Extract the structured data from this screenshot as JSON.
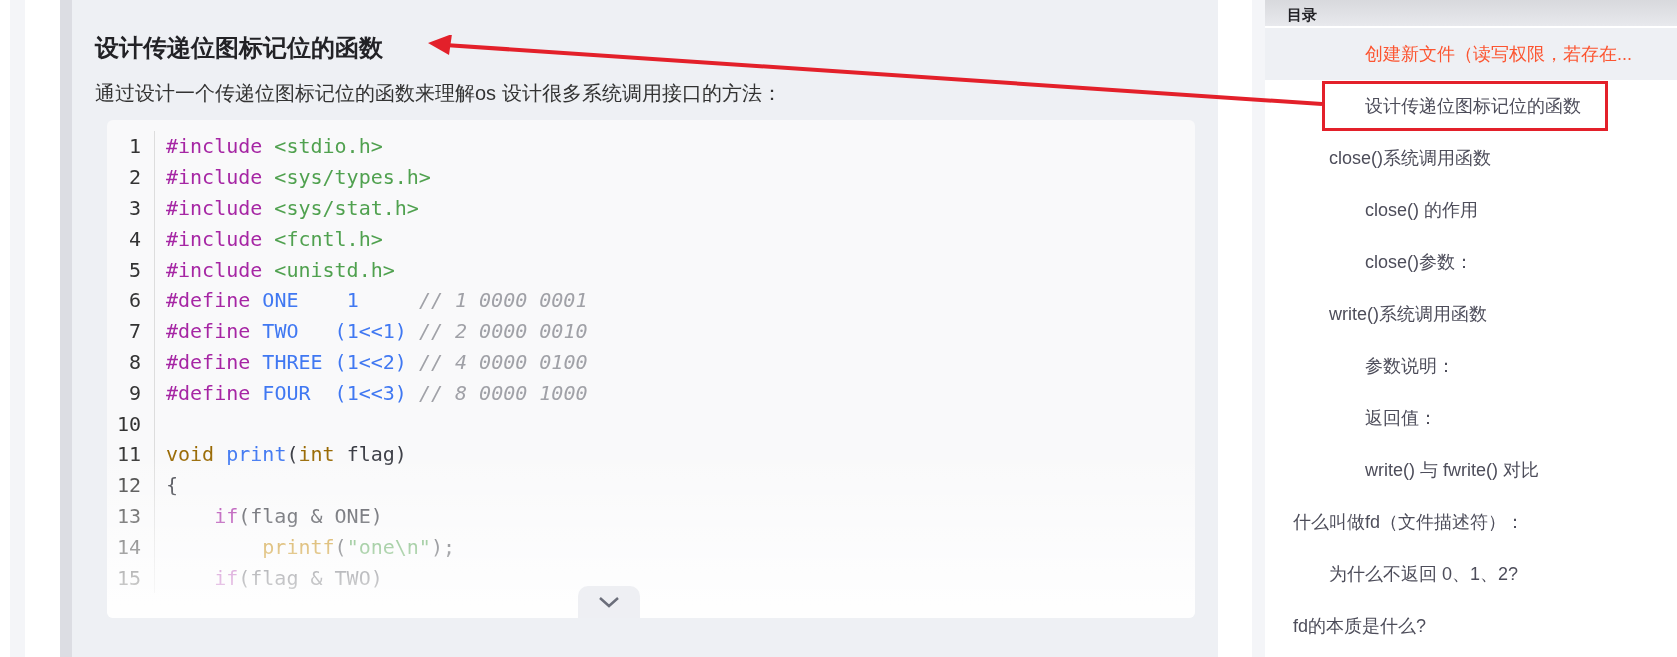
{
  "article": {
    "heading": "设计传递位图标记位的函数",
    "intro": "通过设计一个传递位图标记位的函数来理解os 设计很多系统调用接口的方法：",
    "code": [
      {
        "number": "1",
        "tokens": [
          {
            "kind": "keyword",
            "text": "#include"
          },
          {
            "kind": "string",
            "text": " <stdio.h>"
          }
        ]
      },
      {
        "number": "2",
        "tokens": [
          {
            "kind": "keyword",
            "text": "#include"
          },
          {
            "kind": "string",
            "text": " <sys/types.h>"
          }
        ]
      },
      {
        "number": "3",
        "tokens": [
          {
            "kind": "keyword",
            "text": "#include"
          },
          {
            "kind": "string",
            "text": " <sys/stat.h>"
          }
        ]
      },
      {
        "number": "4",
        "tokens": [
          {
            "kind": "keyword",
            "text": "#include"
          },
          {
            "kind": "string",
            "text": " <fcntl.h>"
          }
        ]
      },
      {
        "number": "5",
        "tokens": [
          {
            "kind": "keyword",
            "text": "#include"
          },
          {
            "kind": "string",
            "text": " <unistd.h>"
          }
        ]
      },
      {
        "number": "6",
        "tokens": [
          {
            "kind": "keyword",
            "text": "#define"
          },
          {
            "kind": "name",
            "text": " ONE    1"
          },
          {
            "kind": "comment",
            "text": "     // 1 0000 0001"
          }
        ]
      },
      {
        "number": "7",
        "tokens": [
          {
            "kind": "keyword",
            "text": "#define"
          },
          {
            "kind": "name",
            "text": " TWO   (1<<1)"
          },
          {
            "kind": "comment",
            "text": " // 2 0000 0010"
          }
        ]
      },
      {
        "number": "8",
        "tokens": [
          {
            "kind": "keyword",
            "text": "#define"
          },
          {
            "kind": "name",
            "text": " THREE (1<<2)"
          },
          {
            "kind": "comment",
            "text": " // 4 0000 0100"
          }
        ]
      },
      {
        "number": "9",
        "tokens": [
          {
            "kind": "keyword",
            "text": "#define"
          },
          {
            "kind": "name",
            "text": " FOUR  (1<<3)"
          },
          {
            "kind": "comment",
            "text": " // 8 0000 1000"
          }
        ]
      },
      {
        "number": "10"
      },
      {
        "number": "11",
        "tokens": [
          {
            "kind": "type",
            "text": "void"
          },
          {
            "kind": "name",
            "text": " print"
          },
          {
            "kind": "plain",
            "text": "("
          },
          {
            "kind": "type",
            "text": "int"
          },
          {
            "kind": "plain",
            "text": " flag)"
          }
        ]
      },
      {
        "number": "12",
        "tokens": [
          {
            "kind": "plain",
            "text": "{"
          }
        ]
      },
      {
        "number": "13",
        "tokens": [
          {
            "kind": "keyword",
            "text": "    if"
          },
          {
            "kind": "plain",
            "text": "(flag & ONE)"
          }
        ]
      },
      {
        "number": "14",
        "tokens": [
          {
            "kind": "function",
            "text": "        printf"
          },
          {
            "kind": "plain",
            "text": "("
          },
          {
            "kind": "string",
            "text": "\"one\\n\""
          },
          {
            "kind": "plain",
            "text": ");"
          }
        ]
      },
      {
        "number": "15",
        "tokens": [
          {
            "kind": "keyword",
            "text": "    if"
          },
          {
            "kind": "plain",
            "text": "(flag & TWO)"
          }
        ]
      }
    ]
  },
  "toc": {
    "title": "目录",
    "items": [
      {
        "children": [
          {
            "children": [
              {
                "text": "创建新文件（读写权限，若存在...",
                "selected": true,
                "boxed": false
              },
              {
                "text": "设计传递位图标记位的函数",
                "selected": false,
                "boxed": true
              }
            ]
          },
          {
            "text": "close()系统调用函数",
            "selected": false,
            "boxed": false,
            "children": [
              {
                "text": "close() 的作用",
                "selected": false,
                "boxed": false
              },
              {
                "text": "close()参数：",
                "selected": false,
                "boxed": false
              }
            ]
          },
          {
            "text": "write()系统调用函数",
            "selected": false,
            "boxed": false,
            "children": [
              {
                "text": "参数说明：",
                "selected": false,
                "boxed": false
              },
              {
                "text": "返回值：",
                "selected": false,
                "boxed": false
              },
              {
                "text": "write() 与 fwrite() 对比",
                "selected": false,
                "boxed": false
              }
            ]
          }
        ]
      },
      {
        "text": "什么叫做fd（文件描述符）：",
        "selected": false,
        "boxed": false,
        "children": [
          {
            "text": "为什么不返回 0、1、2?",
            "selected": false,
            "boxed": false
          }
        ]
      },
      {
        "text": "fd的本质是什么?",
        "selected": false,
        "boxed": false
      }
    ]
  }
}
